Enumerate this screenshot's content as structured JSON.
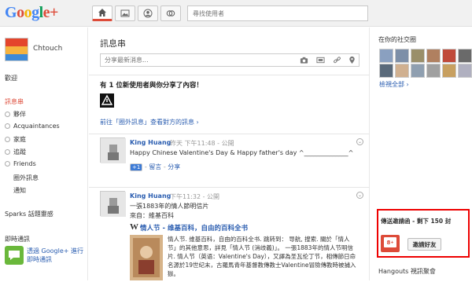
{
  "brand": {
    "logo": "Google+",
    "accent": "#dd4b39",
    "link": "#2a5db0"
  },
  "topbar": {
    "nav_icons": [
      "home-icon",
      "photos-icon",
      "profile-icon",
      "circles-icon"
    ],
    "search_placeholder": "尋找使用者"
  },
  "sidebar": {
    "username": "Chtouch",
    "welcome": "歡迎",
    "stream_label": "訊息串",
    "circles": [
      "夥伴",
      "Acquaintances",
      "家庭",
      "追蹤",
      "Friends"
    ],
    "incoming": "圈外訊息",
    "notifications": "通知",
    "sparks": "Sparks 話題靈感",
    "chat_title": "即時通訊",
    "chat_cta_line1": "透過 Google+ 進行",
    "chat_cta_line2": "即時通訊"
  },
  "stream": {
    "title": "訊息串",
    "share_placeholder": "分享最新消息...",
    "share_icons": [
      "camera-icon",
      "video-icon",
      "link-icon",
      "location-icon"
    ],
    "notice_headline": "有 1 位新使用者與你分享了內容！",
    "notice_link": "前往「圈外訊息」查看對方的訊息 ›",
    "posts": [
      {
        "author": "King Huang",
        "meta_time": "昨天 下午11:48",
        "meta_visibility": "公開",
        "text": "Happy Chinese Valentine's Day & Happy father's day ^______________^",
        "plusone": "+1",
        "comment": "留言",
        "share": "分享"
      },
      {
        "author": "King Huang",
        "meta_time": "下午11:32",
        "meta_visibility": "公開",
        "line1": "一張1883年的情人節明信片",
        "line2": "來自：維基百科",
        "link_title": "情人节 - 维基百科，自由的百科全书",
        "snippet": "情人节. 维基百科，自由的百科全书. 跳转到： 导航, 搜索. 關於「情人节」的其他意思，詳見「情人节 (消歧義)」。 一張1883年的情人节明信片. 情人节（英语：Valentine's Day），又譯為圣瓦伦丁节，相傳節日命名源於19世纪末，古羅馬青年基督教傳教士Valentine冒險傳教時被捕入獄。"
      }
    ]
  },
  "right": {
    "circles_title": "在你的社交圈",
    "more_link": "檢視全部 ›",
    "invite_title": "傳送邀請函 - 剩下 150 封",
    "invite_button": "邀請好友",
    "hangouts_title": "Hangouts 視訊聚會"
  }
}
